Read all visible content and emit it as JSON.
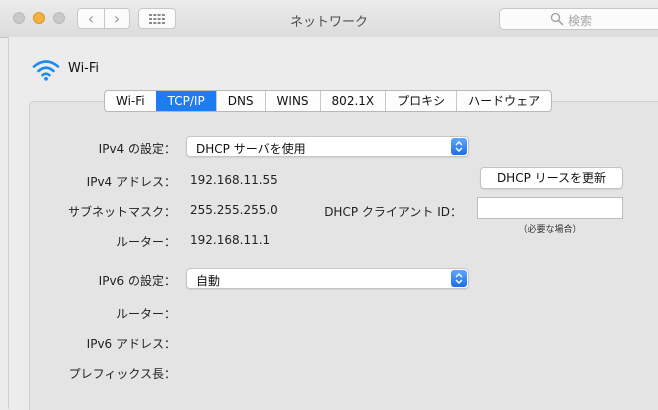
{
  "window": {
    "title": "ネットワーク",
    "search_placeholder": "検索",
    "nav_back": "‹",
    "nav_forward": "›"
  },
  "interface": {
    "name": "Wi-Fi",
    "icon": "wifi-icon"
  },
  "tabs": [
    {
      "label": "Wi-Fi",
      "selected": false
    },
    {
      "label": "TCP/IP",
      "selected": true
    },
    {
      "label": "DNS",
      "selected": false
    },
    {
      "label": "WINS",
      "selected": false
    },
    {
      "label": "802.1X",
      "selected": false
    },
    {
      "label": "プロキシ",
      "selected": false
    },
    {
      "label": "ハードウェア",
      "selected": false
    }
  ],
  "ipv4": {
    "config_label": "IPv4 の設定：",
    "config_value": "DHCP サーバを使用",
    "address_label": "IPv4 アドレス：",
    "address_value": "192.168.11.55",
    "subnet_label": "サブネットマスク：",
    "subnet_value": "255.255.255.0",
    "router_label": "ルーター：",
    "router_value": "192.168.11.1",
    "renew_button": "DHCP リースを更新",
    "client_id_label": "DHCP クライアント ID：",
    "client_id_value": "",
    "client_id_hint": "（必要な場合）"
  },
  "ipv6": {
    "config_label": "IPv6 の設定：",
    "config_value": "自動",
    "router_label": "ルーター：",
    "address_label": "IPv6 アドレス：",
    "prefix_label": "プレフィックス長："
  },
  "colors": {
    "accent": "#1d7cf2",
    "minimize_light": "#f5b33e"
  }
}
